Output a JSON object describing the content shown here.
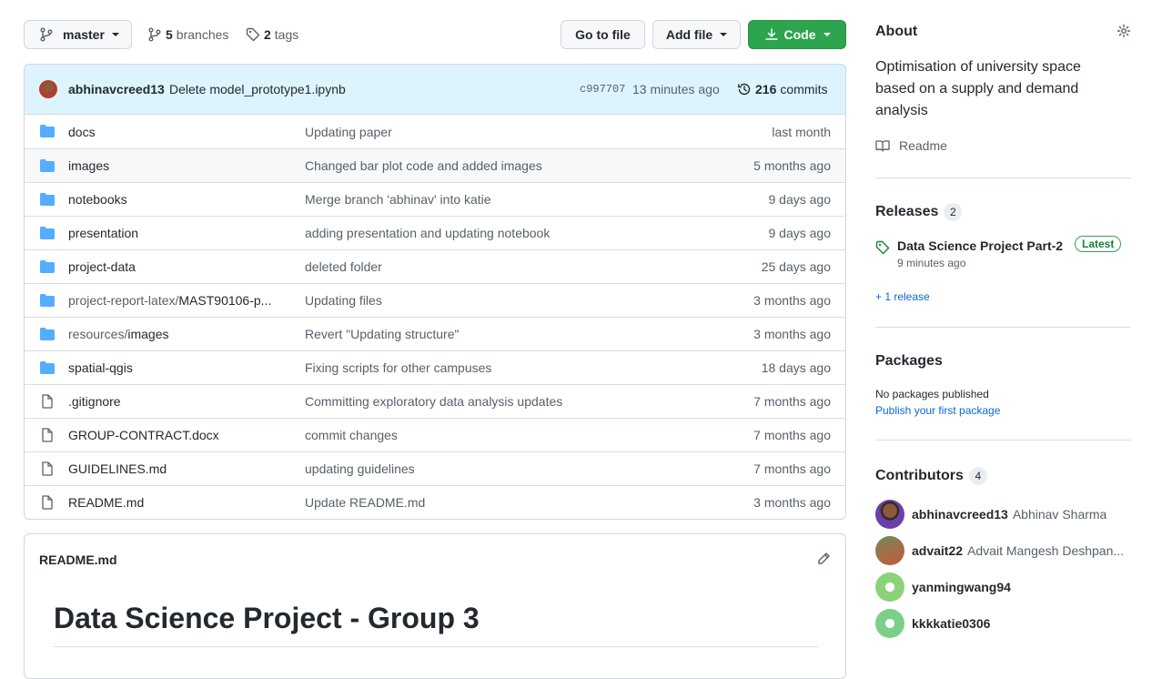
{
  "toolbar": {
    "branch": "master",
    "branches_count": "5",
    "branches_label": "branches",
    "tags_count": "2",
    "tags_label": "tags",
    "goto_file": "Go to file",
    "add_file": "Add file",
    "code": "Code"
  },
  "commit": {
    "author": "abhinavcreed13",
    "message": "Delete model_prototype1.ipynb",
    "sha": "c997707",
    "time": "13 minutes ago",
    "count": "216",
    "count_label": "commits"
  },
  "files": [
    {
      "type": "folder",
      "prefix": "",
      "name": "docs",
      "message": "Updating paper",
      "age": "last month"
    },
    {
      "type": "folder",
      "prefix": "",
      "name": "images",
      "message": "Changed bar plot code and added images",
      "age": "5 months ago"
    },
    {
      "type": "folder",
      "prefix": "",
      "name": "notebooks",
      "message": "Merge branch 'abhinav' into katie",
      "age": "9 days ago"
    },
    {
      "type": "folder",
      "prefix": "",
      "name": "presentation",
      "message": "adding presentation and updating notebook",
      "age": "9 days ago"
    },
    {
      "type": "folder",
      "prefix": "",
      "name": "project-data",
      "message": "deleted folder",
      "age": "25 days ago"
    },
    {
      "type": "folder",
      "prefix": "project-report-latex/",
      "name": "MAST90106-p...",
      "message": "Updating files",
      "age": "3 months ago"
    },
    {
      "type": "folder",
      "prefix": "resources/",
      "name": "images",
      "message": "Revert \"Updating structure\"",
      "age": "3 months ago"
    },
    {
      "type": "folder",
      "prefix": "",
      "name": "spatial-qgis",
      "message": "Fixing scripts for other campuses",
      "age": "18 days ago"
    },
    {
      "type": "file",
      "prefix": "",
      "name": ".gitignore",
      "message": "Committing exploratory data analysis updates",
      "age": "7 months ago"
    },
    {
      "type": "file",
      "prefix": "",
      "name": "GROUP-CONTRACT.docx",
      "message": "commit changes",
      "age": "7 months ago"
    },
    {
      "type": "file",
      "prefix": "",
      "name": "GUIDELINES.md",
      "message": "updating guidelines",
      "age": "7 months ago"
    },
    {
      "type": "file",
      "prefix": "",
      "name": "README.md",
      "message": "Update README.md",
      "age": "3 months ago"
    }
  ],
  "readme": {
    "filename": "README.md",
    "heading": "Data Science Project - Group 3"
  },
  "about": {
    "title": "About",
    "description": "Optimisation of university space based on a supply and demand analysis",
    "readme_link": "Readme"
  },
  "releases": {
    "title": "Releases",
    "count": "2",
    "latest_name": "Data Science Project Part-2",
    "latest_badge": "Latest",
    "latest_time": "9 minutes ago",
    "more": "+ 1 release"
  },
  "packages": {
    "title": "Packages",
    "none": "No packages published",
    "publish": "Publish your first package"
  },
  "contributors": {
    "title": "Contributors",
    "count": "4",
    "list": [
      {
        "login": "abhinavcreed13",
        "name": "Abhinav Sharma"
      },
      {
        "login": "advait22",
        "name": "Advait Mangesh Deshpan..."
      },
      {
        "login": "yanmingwang94",
        "name": ""
      },
      {
        "login": "kkkkatie0306",
        "name": ""
      }
    ]
  },
  "colors": {
    "accent_green": "#2da44e",
    "link_blue": "#0969da",
    "folder_blue": "#54aeff",
    "commit_bar": "#ddf4ff"
  }
}
